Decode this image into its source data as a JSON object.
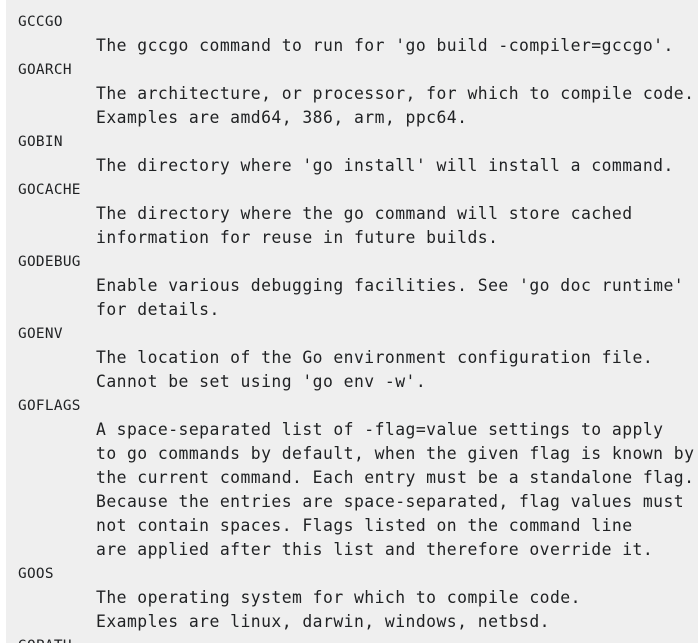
{
  "env_vars": [
    {
      "name": "GCCGO",
      "lines": [
        "The gccgo command to run for 'go build -compiler=gccgo'."
      ]
    },
    {
      "name": "GOARCH",
      "lines": [
        "The architecture, or processor, for which to compile code.",
        "Examples are amd64, 386, arm, ppc64."
      ]
    },
    {
      "name": "GOBIN",
      "lines": [
        "The directory where 'go install' will install a command."
      ]
    },
    {
      "name": "GOCACHE",
      "lines": [
        "The directory where the go command will store cached",
        "information for reuse in future builds."
      ]
    },
    {
      "name": "GODEBUG",
      "lines": [
        "Enable various debugging facilities. See 'go doc runtime'",
        "for details."
      ]
    },
    {
      "name": "GOENV",
      "lines": [
        "The location of the Go environment configuration file.",
        "Cannot be set using 'go env -w'."
      ]
    },
    {
      "name": "GOFLAGS",
      "lines": [
        "A space-separated list of -flag=value settings to apply",
        "to go commands by default, when the given flag is known by",
        "the current command. Each entry must be a standalone flag.",
        "Because the entries are space-separated, flag values must",
        "not contain spaces. Flags listed on the command line",
        "are applied after this list and therefore override it."
      ]
    },
    {
      "name": "GOOS",
      "lines": [
        "The operating system for which to compile code.",
        "Examples are linux, darwin, windows, netbsd."
      ]
    },
    {
      "name": "GOPATH",
      "lines": []
    }
  ]
}
